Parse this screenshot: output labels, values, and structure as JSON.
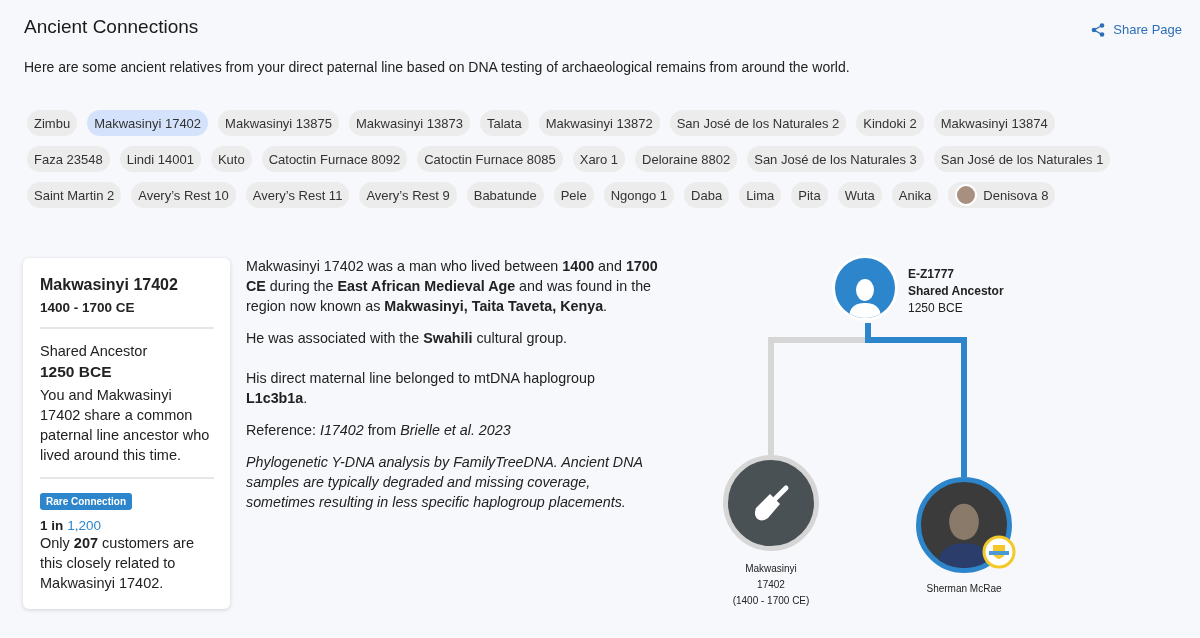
{
  "page": {
    "title": "Ancient Connections",
    "share_label": "Share Page",
    "description": "Here are some ancient relatives from your direct paternal line based on DNA testing of archaeological remains from around the world."
  },
  "chips": [
    {
      "label": "Zimbu",
      "selected": false,
      "thumbnail": false
    },
    {
      "label": "Makwasinyi 17402",
      "selected": true,
      "thumbnail": false
    },
    {
      "label": "Makwasinyi 13875",
      "selected": false,
      "thumbnail": false
    },
    {
      "label": "Makwasinyi 13873",
      "selected": false,
      "thumbnail": false
    },
    {
      "label": "Talata",
      "selected": false,
      "thumbnail": false
    },
    {
      "label": "Makwasinyi 13872",
      "selected": false,
      "thumbnail": false
    },
    {
      "label": "San José de los Naturales 2",
      "selected": false,
      "thumbnail": false
    },
    {
      "label": "Kindoki 2",
      "selected": false,
      "thumbnail": false
    },
    {
      "label": "Makwasinyi 13874",
      "selected": false,
      "thumbnail": false
    },
    {
      "label": "Faza 23548",
      "selected": false,
      "thumbnail": false
    },
    {
      "label": "Lindi 14001",
      "selected": false,
      "thumbnail": false
    },
    {
      "label": "Kuto",
      "selected": false,
      "thumbnail": false
    },
    {
      "label": "Catoctin Furnace 8092",
      "selected": false,
      "thumbnail": false
    },
    {
      "label": "Catoctin Furnace 8085",
      "selected": false,
      "thumbnail": false
    },
    {
      "label": "Xaro 1",
      "selected": false,
      "thumbnail": false
    },
    {
      "label": "Deloraine 8802",
      "selected": false,
      "thumbnail": false
    },
    {
      "label": "San José de los Naturales 3",
      "selected": false,
      "thumbnail": false
    },
    {
      "label": "San José de los Naturales 1",
      "selected": false,
      "thumbnail": false
    },
    {
      "label": "Saint Martin 2",
      "selected": false,
      "thumbnail": false
    },
    {
      "label": "Avery’s Rest 10",
      "selected": false,
      "thumbnail": false
    },
    {
      "label": "Avery’s Rest 11",
      "selected": false,
      "thumbnail": false
    },
    {
      "label": "Avery’s Rest 9",
      "selected": false,
      "thumbnail": false
    },
    {
      "label": "Babatunde",
      "selected": false,
      "thumbnail": false
    },
    {
      "label": "Pele",
      "selected": false,
      "thumbnail": false
    },
    {
      "label": "Ngongo 1",
      "selected": false,
      "thumbnail": false
    },
    {
      "label": "Daba",
      "selected": false,
      "thumbnail": false
    },
    {
      "label": "Lima",
      "selected": false,
      "thumbnail": false
    },
    {
      "label": "Pita",
      "selected": false,
      "thumbnail": false
    },
    {
      "label": "Wuta",
      "selected": false,
      "thumbnail": false
    },
    {
      "label": "Anika",
      "selected": false,
      "thumbnail": false
    },
    {
      "label": "Denisova 8",
      "selected": false,
      "thumbnail": true
    }
  ],
  "card": {
    "name": "Makwasinyi 17402",
    "dates": "1400 - 1700 CE",
    "ancestor_label": "Shared Ancestor",
    "ancestor_date": "1250 BCE",
    "ancestor_text": "You and Makwasinyi 17402 share a common paternal line ancestor who lived around this time.",
    "badge": "Rare Connection",
    "rarity_prefix": "1 in",
    "rarity_value": "1,200",
    "rarity_text": "Only **207** customers are this closely related to Makwasinyi 17402."
  },
  "details": [
    {
      "text": "Makwasinyi 17402 was a man who lived between **1400** and **1700 CE** during the **East African Medieval Age** and was found in the region now known as **Makwasinyi, Taita Taveta, Kenya**.",
      "italic": false
    },
    {
      "text": "He was associated with the **Swahili** cultural group.",
      "italic": false
    },
    {
      "text": "His direct maternal line belonged to mtDNA haplogroup **L1c3b1a**.",
      "italic": false
    },
    {
      "text": "Reference: *I17402* from *Brielle et al. 2023*",
      "italic": false
    },
    {
      "text": "Phylogenetic Y-DNA analysis by FamilyTreeDNA. Ancient DNA samples are typically degraded and missing coverage, sometimes resulting in less specific haplogroup placements.",
      "italic": true
    }
  ],
  "tree": {
    "root": {
      "code": "E-Z1777",
      "label": "Shared Ancestor",
      "date": "1250 BCE"
    },
    "children": [
      {
        "kind": "ancient",
        "name": "Makwasinyi 17402",
        "dates": "(1400 - 1700 CE)",
        "highlighted": false
      },
      {
        "kind": "user",
        "name": "Sherman McRae",
        "highlighted": true
      }
    ]
  }
}
